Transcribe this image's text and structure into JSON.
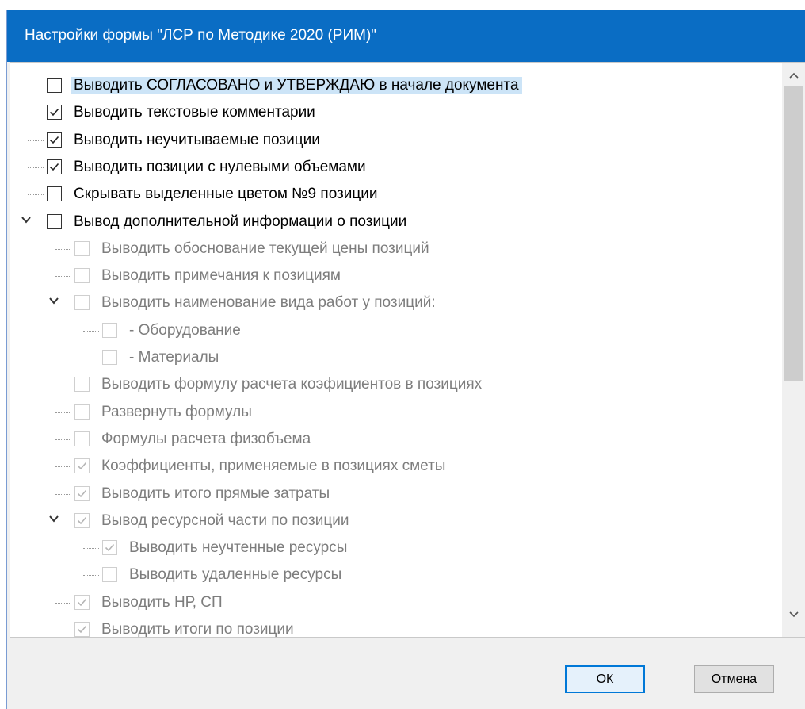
{
  "dialog": {
    "title": "Настройки формы \"ЛСР по Методике 2020 (РИМ)\"",
    "ok_label": "ОК",
    "cancel_label": "Отмена"
  },
  "tree": {
    "items": [
      {
        "label": "Выводить СОГЛАСОВАНО и УТВЕРЖДАЮ в начале документа",
        "checked": false,
        "enabled": true,
        "level": 0,
        "selected": true
      },
      {
        "label": "Выводить текстовые комментарии",
        "checked": true,
        "enabled": true,
        "level": 0
      },
      {
        "label": "Выводить неучитываемые позиции",
        "checked": true,
        "enabled": true,
        "level": 0
      },
      {
        "label": "Выводить позиции с нулевыми объемами",
        "checked": true,
        "enabled": true,
        "level": 0
      },
      {
        "label": "Скрывать выделенные цветом №9 позиции",
        "checked": false,
        "enabled": true,
        "level": 0
      },
      {
        "label": "Вывод дополнительной информации о позиции",
        "checked": false,
        "enabled": true,
        "level": 0,
        "expanded": true
      },
      {
        "label": "Выводить обоснование текущей цены позиций",
        "checked": false,
        "enabled": false,
        "level": 1
      },
      {
        "label": "Выводить примечания к позициям",
        "checked": false,
        "enabled": false,
        "level": 1
      },
      {
        "label": "Выводить наименование вида работ у позиций:",
        "checked": false,
        "enabled": false,
        "level": 1,
        "expanded": true
      },
      {
        "label": "- Оборудование",
        "checked": false,
        "enabled": false,
        "level": 2
      },
      {
        "label": "- Материалы",
        "checked": false,
        "enabled": false,
        "level": 2
      },
      {
        "label": "Выводить формулу расчета коэфициентов в позициях",
        "checked": false,
        "enabled": false,
        "level": 1
      },
      {
        "label": "Развернуть формулы",
        "checked": false,
        "enabled": false,
        "level": 1
      },
      {
        "label": "Формулы расчета физобъема",
        "checked": false,
        "enabled": false,
        "level": 1
      },
      {
        "label": "Коэффициенты, применяемые в позициях сметы",
        "checked": true,
        "enabled": false,
        "level": 1
      },
      {
        "label": "Выводить итого прямые затраты",
        "checked": true,
        "enabled": false,
        "level": 1
      },
      {
        "label": "Вывод ресурсной части по позиции",
        "checked": true,
        "enabled": false,
        "level": 1,
        "expanded": true
      },
      {
        "label": "Выводить неучтенные ресурсы",
        "checked": true,
        "enabled": false,
        "level": 2
      },
      {
        "label": "Выводить удаленные ресурсы",
        "checked": false,
        "enabled": false,
        "level": 2
      },
      {
        "label": "Выводить НР, СП",
        "checked": true,
        "enabled": false,
        "level": 1
      },
      {
        "label": "Выводить итоги по позиции",
        "checked": true,
        "enabled": false,
        "level": 1
      }
    ]
  },
  "icons": {
    "scroll_up": "chevron-up-icon",
    "scroll_down": "chevron-down-icon",
    "expand": "chevron-down-icon",
    "check": "checkmark-icon"
  },
  "colors": {
    "titlebar": "#0a6dc4",
    "selection": "#cce4f7",
    "default_button_border": "#0078d7"
  }
}
